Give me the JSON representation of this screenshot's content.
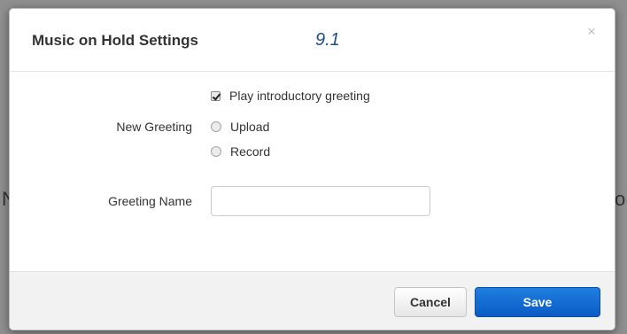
{
  "backdrop": {
    "left_fragment": "N",
    "right_fragment": "o"
  },
  "modal": {
    "title": "Music on Hold Settings",
    "version_tag": "9.1",
    "close_glyph": "×"
  },
  "form": {
    "new_greeting_label": "New Greeting",
    "options": {
      "intro": {
        "label": "Play introductory greeting",
        "checked": true
      },
      "upload": {
        "label": "Upload",
        "selected": false
      },
      "record": {
        "label": "Record",
        "selected": false
      }
    },
    "greeting_name_label": "Greeting Name",
    "greeting_name_value": "",
    "greeting_name_placeholder": ""
  },
  "footer": {
    "cancel_label": "Cancel",
    "save_label": "Save"
  },
  "colors": {
    "primary": "#0a5bc4",
    "version_tag": "#1f4f8a",
    "overlay": "#8f8f8f"
  },
  "icons": {
    "close": "close-icon",
    "checkbox": "checkbox-checked-icon",
    "radio": "radio-unselected-icon"
  }
}
